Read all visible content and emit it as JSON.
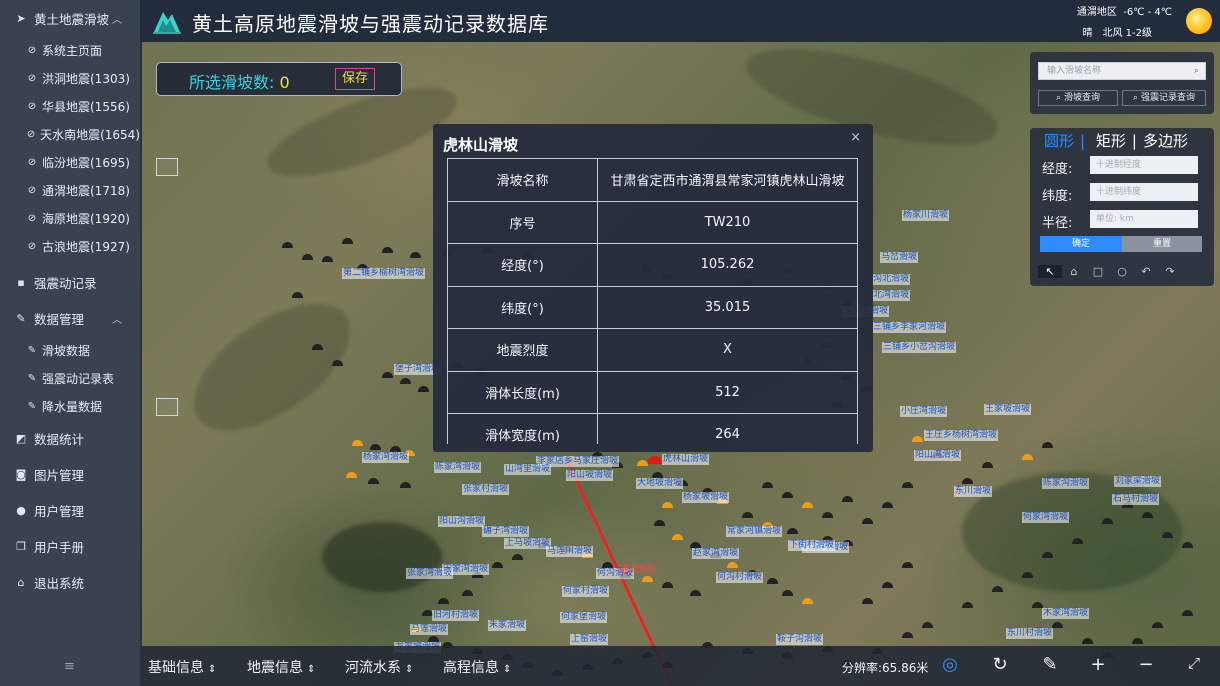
{
  "sidebar": {
    "group_quake": "黄土地震滑坡",
    "quake_items": [
      "系统主页面",
      "洪洞地震(1303)",
      "华县地震(1556)",
      "天水南地震(1654)",
      "临汾地震(1695)",
      "通渭地震(1718)",
      "海原地震(1920)",
      "古浪地震(1927)"
    ],
    "strong_motion": "强震动记录",
    "data_mgmt": "数据管理",
    "data_items": [
      "滑坡数据",
      "强震动记录表",
      "降水量数据"
    ],
    "stats": "数据统计",
    "images": "图片管理",
    "users": "用户管理",
    "manual": "用户手册",
    "logout": "退出系统"
  },
  "header": {
    "title": "黄土高原地震滑坡与强震动记录数据库",
    "location": "通渭地区",
    "temperature": "-6℃ - 4℃",
    "weather": "晴",
    "wind": "北风 1-2级"
  },
  "count_box": {
    "label": "所选滑坡数: ",
    "count": "0",
    "save": "保存"
  },
  "search": {
    "placeholder": "输入滑坡名称",
    "landslide_query": "滑坡查询",
    "record_query": "强震记录查询"
  },
  "shape_panel": {
    "tabs": [
      "圆形",
      "矩形",
      "多边形"
    ],
    "lon_label": "经度:",
    "lon_placeholder": "十进制经度",
    "lat_label": "纬度:",
    "lat_placeholder": "十进制纬度",
    "radius_label": "半径:",
    "radius_placeholder": "单位: km",
    "confirm": "确定",
    "reset": "重置"
  },
  "popup": {
    "title": "虎林山滑坡",
    "rows": [
      [
        "滑坡名称",
        "甘肃省定西市通渭县常家河镇虎林山滑坡"
      ],
      [
        "序号",
        "TW210"
      ],
      [
        "经度(°)",
        "105.262"
      ],
      [
        "纬度(°)",
        "35.015"
      ],
      [
        "地震烈度",
        "X"
      ],
      [
        "滑体长度(m)",
        "512"
      ],
      [
        "滑体宽度(m)",
        "264"
      ]
    ]
  },
  "map_labels": [
    "杨家川滑坡",
    "马岔滑坡",
    "沟北滑坡",
    "北湾滑坡",
    "三铺乡李家河滑坡",
    "庞家湾滑坡",
    "三铺乡小岔沟滑坡",
    "第二铺乡榆树湾滑坡",
    "堡子湾滑坡",
    "小庄湾滑坡",
    "王家坡滑坡",
    "王庄乡杨树湾滑坡",
    "阳山湾滑坡",
    "杨家湾滑坡",
    "虎林山滑坡",
    "李家店乡马家庄滑坡",
    "陈家湾滑坡",
    "山湾里滑坡",
    "阳山坡滑坡",
    "大地坡滑坡",
    "东川滑坡",
    "陈家沟滑坡",
    "刘家梁滑坡",
    "张家村滑坡",
    "杨家坡滑坡",
    "苏家湾滑坡",
    "石马村滑坡",
    "何家湾滑坡",
    "阳山沟滑坡",
    "碾子湾滑坡",
    "上马坡滑坡",
    "马莲川滑坡",
    "宋家湾滑坡",
    "张家湾滑坡",
    "常家河镇滑坡",
    "赵家湾滑坡",
    "下街村滑坡",
    "何家村滑坡",
    "旧河村滑坡",
    "何家堡滑坡",
    "朱家滑坡",
    "上窑滑坡",
    "鞍子沟滑坡",
    "马莲滑坡",
    "龙家坡滑坡",
    "东川村滑坡",
    "何沟滑坡",
    "何沟村滑坡",
    "木家湾滑坡"
  ],
  "map_red_label": "通渭断裂",
  "bottombar": {
    "menus": [
      "基础信息",
      "地震信息",
      "河流水系",
      "高程信息"
    ],
    "resolution": "分辨率:65.86米"
  }
}
